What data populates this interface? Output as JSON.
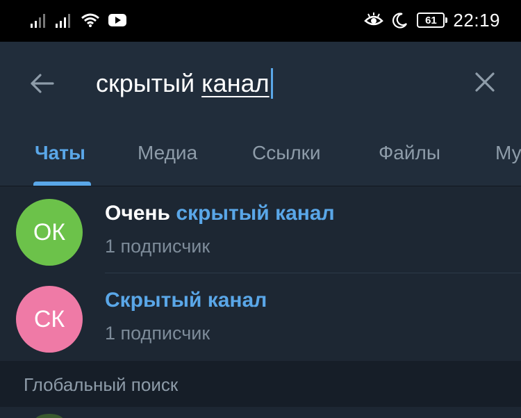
{
  "status_bar": {
    "time": "22:19",
    "battery": "61",
    "icons": [
      "signal-icon",
      "signal-icon",
      "wifi-icon",
      "youtube-icon",
      "eye-icon",
      "moon-icon",
      "battery-icon"
    ]
  },
  "search": {
    "query_plain": "скрытый",
    "query_underlined": "канал"
  },
  "tabs": [
    {
      "label": "Чаты",
      "active": true
    },
    {
      "label": "Медиа",
      "active": false
    },
    {
      "label": "Ссылки",
      "active": false
    },
    {
      "label": "Файлы",
      "active": false
    },
    {
      "label": "Му",
      "active": false
    }
  ],
  "results": [
    {
      "initials": "ОК",
      "avatar_color": "#6cc24a",
      "title_prefix": "Очень ",
      "title_highlight": "скрытый канал",
      "subtitle": "1 подписчик"
    },
    {
      "initials": "СК",
      "avatar_color": "#ef7aa6",
      "title_prefix": "",
      "title_highlight": "Скрытый канал",
      "subtitle": "1 подписчик"
    }
  ],
  "section": {
    "label": "Глобальный поиск"
  },
  "colors": {
    "accent": "#5aa7e8",
    "background": "#1d2733",
    "header": "#212d3b"
  }
}
